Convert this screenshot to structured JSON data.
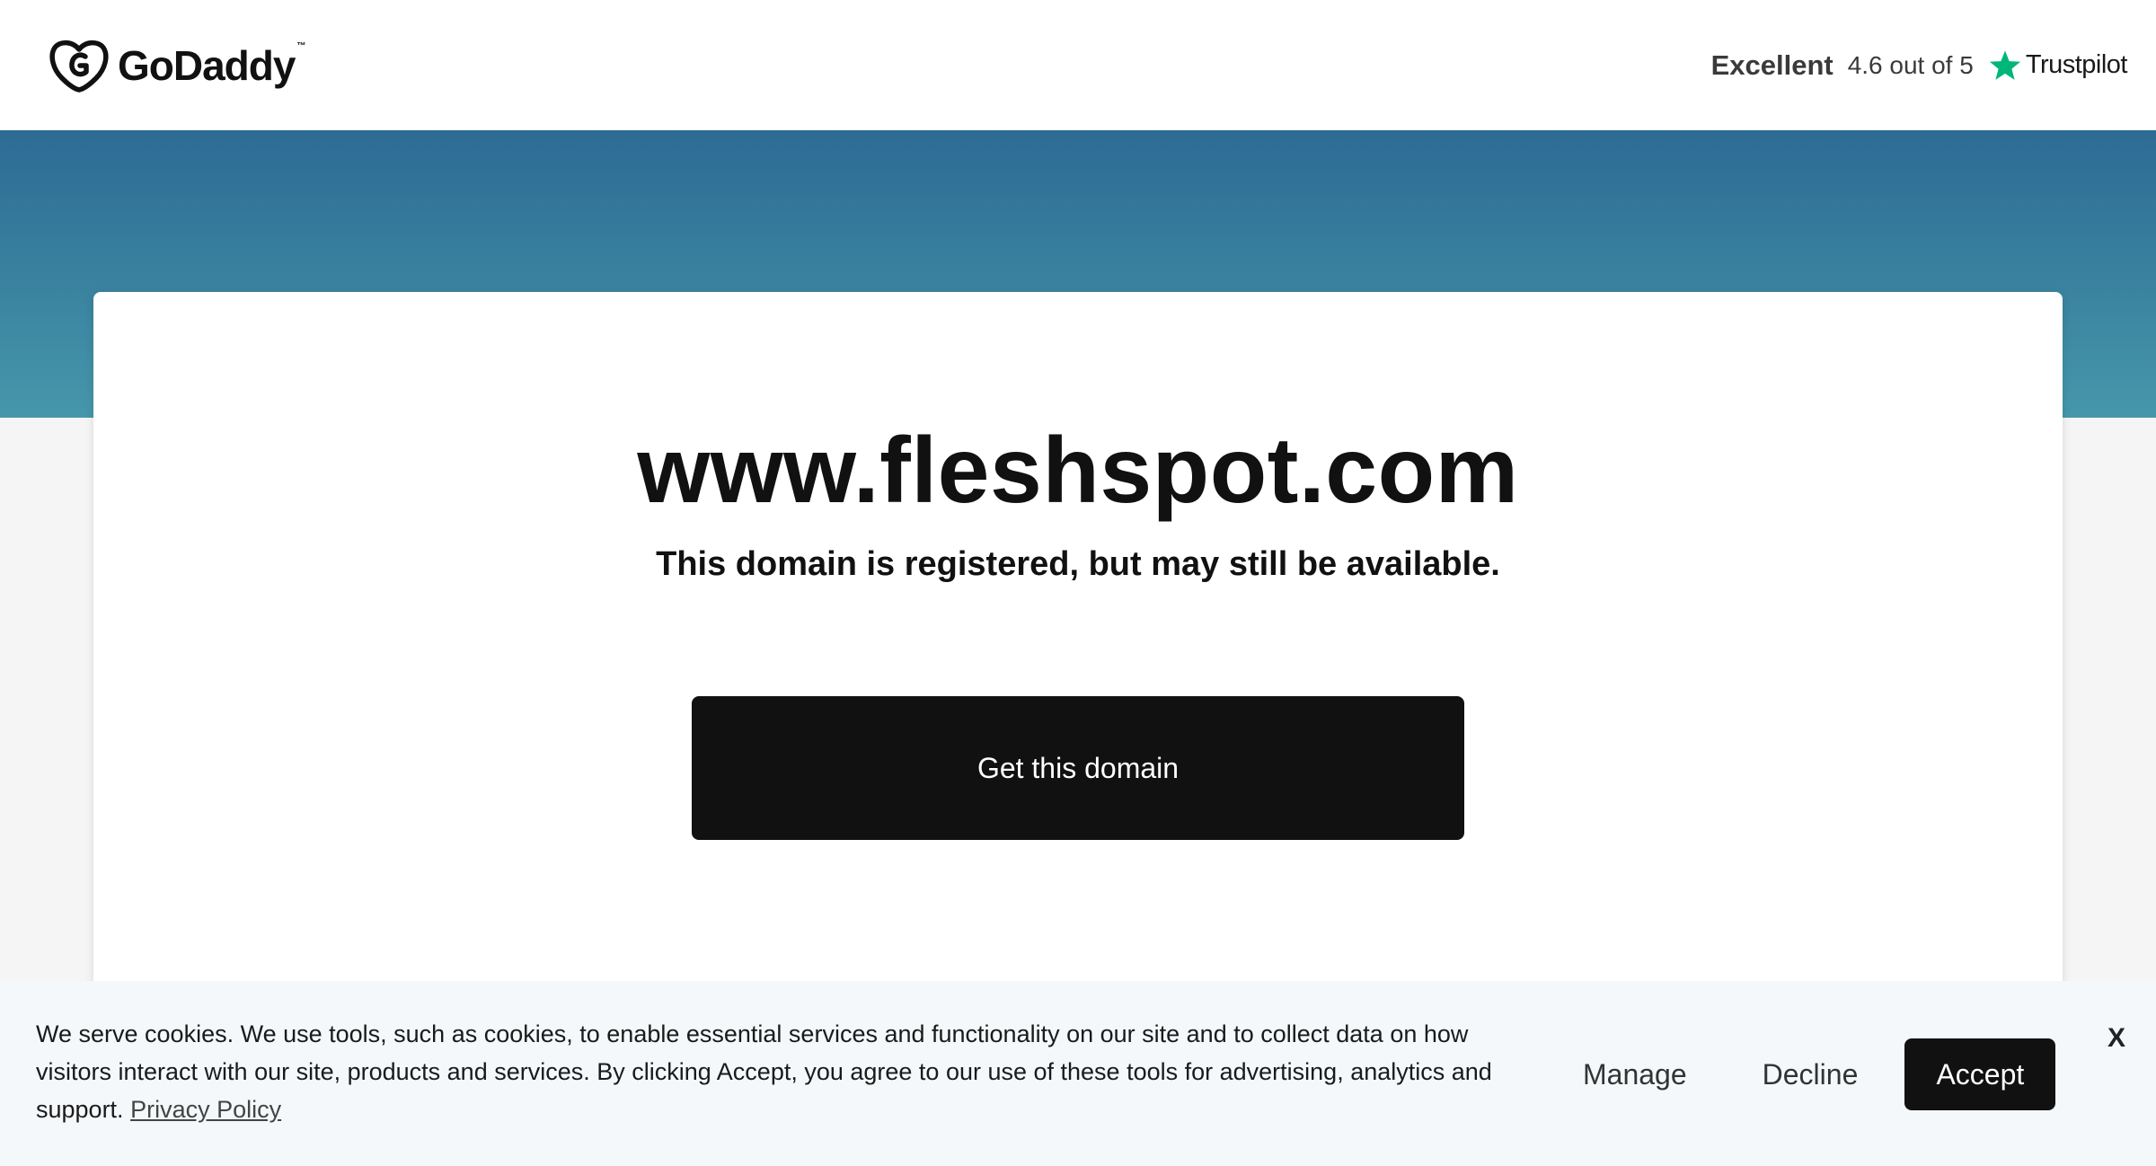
{
  "header": {
    "logo_text": "GoDaddy",
    "logo_tm": "™",
    "trustpilot": {
      "rating_word": "Excellent",
      "score_text": "4.6 out of 5",
      "brand": "Trustpilot",
      "star_color": "#00b67a"
    }
  },
  "hero": {
    "gradient_top": "#2d6b94",
    "gradient_bottom": "#4697ab"
  },
  "main": {
    "domain": "www.fleshspot.com",
    "subtitle": "This domain is registered, but may still be available.",
    "cta_label": "Get this domain"
  },
  "cookie_banner": {
    "message": "We serve cookies. We use tools, such as cookies, to enable essential services and functionality on our site and to collect data on how visitors interact with our site, products and services. By clicking Accept, you agree to our use of these tools for advertising, analytics and support.",
    "privacy_link": "Privacy Policy",
    "manage_label": "Manage",
    "decline_label": "Decline",
    "accept_label": "Accept",
    "close_label": "X"
  }
}
